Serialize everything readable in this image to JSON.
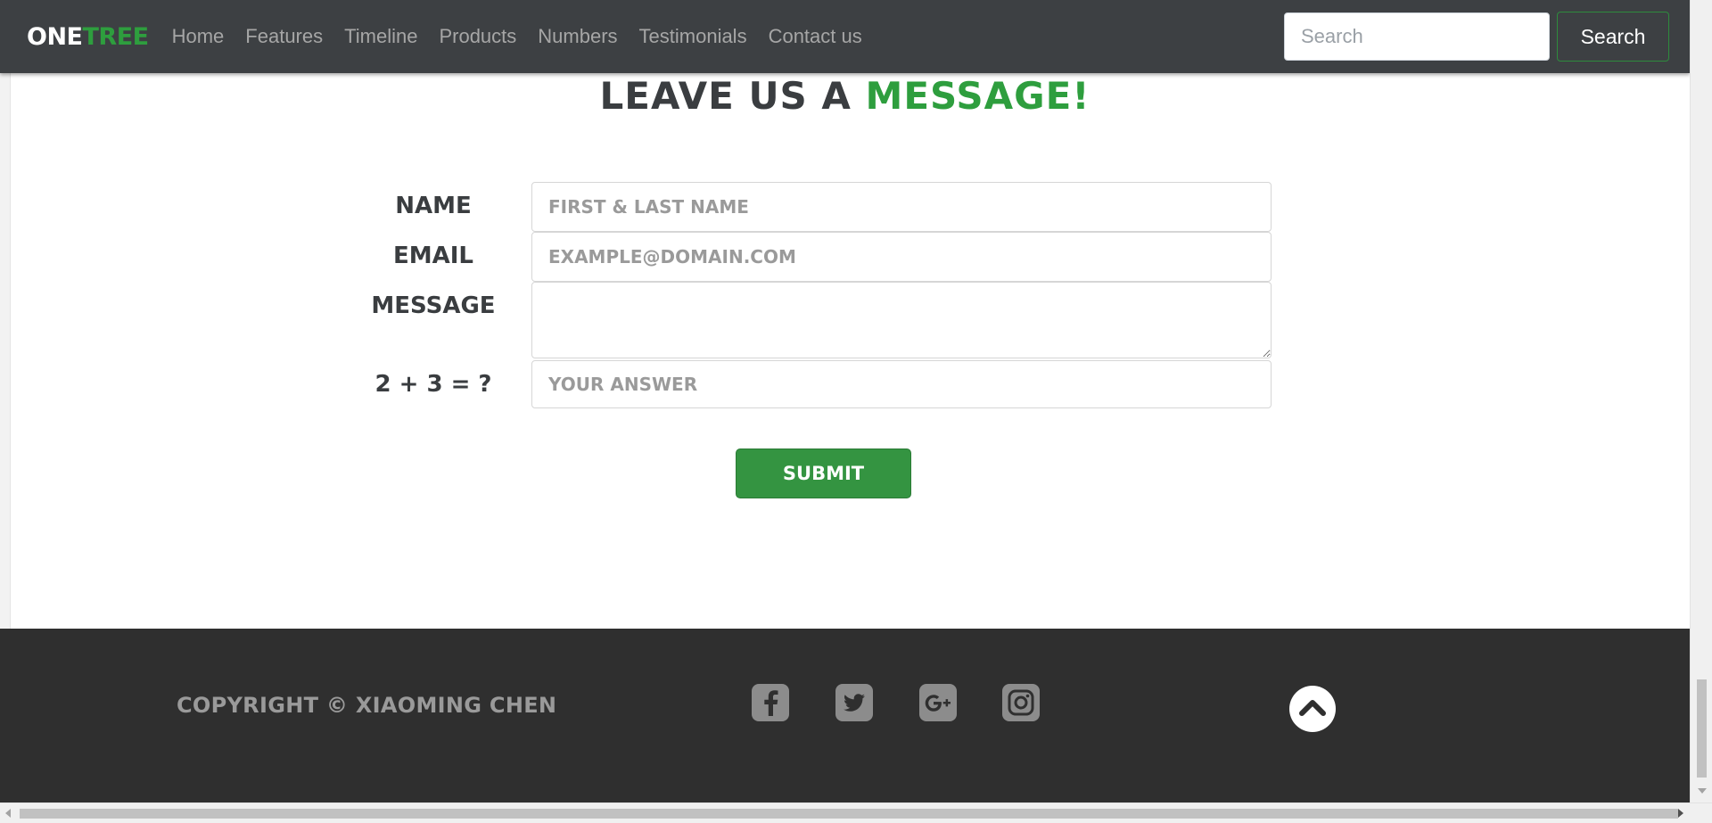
{
  "navbar": {
    "brand_part1": "ONE",
    "brand_part2": "TREE",
    "links": [
      "Home",
      "Features",
      "Timeline",
      "Products",
      "Numbers",
      "Testimonials",
      "Contact us"
    ],
    "search_placeholder": "Search",
    "search_button": "Search"
  },
  "contact": {
    "heading_part1": "LEAVE US A ",
    "heading_part2": "MESSAGE!",
    "name_label": "NAME",
    "name_placeholder": "FIRST & LAST NAME",
    "email_label": "EMAIL",
    "email_placeholder": "EXAMPLE@DOMAIN.COM",
    "message_label": "MESSAGE",
    "captcha_label": "2 + 3 = ?",
    "captcha_placeholder": "YOUR ANSWER",
    "submit_label": "SUBMIT"
  },
  "footer": {
    "copyright": "COPYRIGHT © XIAOMING CHEN",
    "social_icons": [
      "facebook-icon",
      "twitter-icon",
      "google-plus-icon",
      "instagram-icon"
    ],
    "back_to_top_icon": "chevron-up-icon"
  },
  "colors": {
    "brand_green": "#2e9e3e",
    "navbar_bg": "#3d4043",
    "footer_bg": "#2f2f2f",
    "submit_bg": "#349441"
  }
}
